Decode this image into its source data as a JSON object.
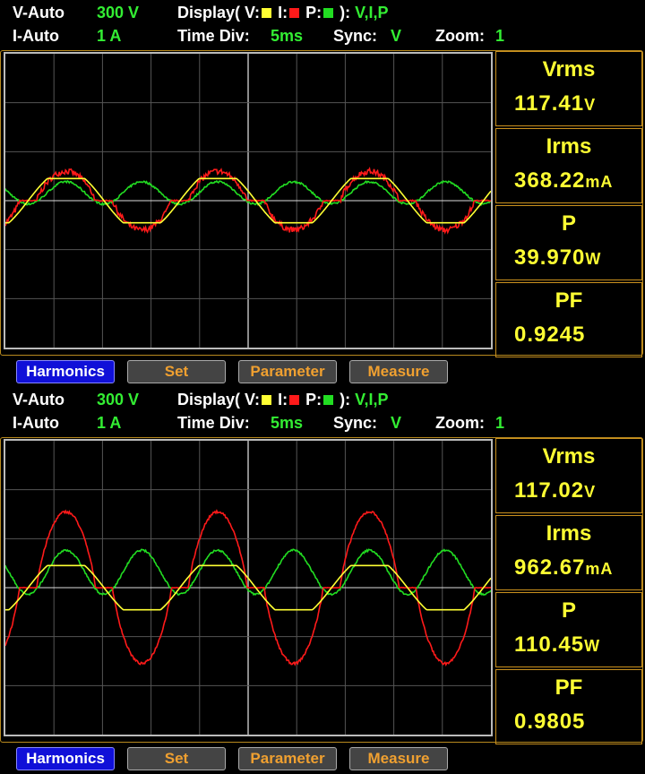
{
  "panels": [
    {
      "header": {
        "v_range_label": "V-Auto",
        "v_range_value": "300 V",
        "i_range_label": "I-Auto",
        "i_range_value": "1 A",
        "display_label": "Display(",
        "display_v": "V:",
        "display_i": "I:",
        "display_p": "P:",
        "display_close": "):",
        "display_value": "V,I,P",
        "time_div_label": "Time  Div:",
        "time_div_value": "5ms",
        "sync_label": "Sync:",
        "sync_value": "V",
        "zoom_label": "Zoom:",
        "zoom_value": "1"
      },
      "measurements": [
        {
          "label": "Vrms",
          "value": "117.41",
          "unit": "V"
        },
        {
          "label": "Irms",
          "value": "368.22",
          "unit": "mA"
        },
        {
          "label": "P",
          "value": "39.970",
          "unit": "W"
        },
        {
          "label": "PF",
          "value": "0.9245",
          "unit": ""
        }
      ],
      "softkeys": {
        "harmonics": "Harmonics",
        "set": "Set",
        "parameter": "Parameter",
        "measure": "Measure"
      }
    },
    {
      "header": {
        "v_range_label": "V-Auto",
        "v_range_value": "300 V",
        "i_range_label": "I-Auto",
        "i_range_value": "1 A",
        "display_label": "Display(",
        "display_v": "V:",
        "display_i": "I:",
        "display_p": "P:",
        "display_close": "):",
        "display_value": "V,I,P",
        "time_div_label": "Time  Div:",
        "time_div_value": "5ms",
        "sync_label": "Sync:",
        "sync_value": "V",
        "zoom_label": "Zoom:",
        "zoom_value": "1"
      },
      "measurements": [
        {
          "label": "Vrms",
          "value": "117.02",
          "unit": "V"
        },
        {
          "label": "Irms",
          "value": "962.67",
          "unit": "mA"
        },
        {
          "label": "P",
          "value": "110.45",
          "unit": "W"
        },
        {
          "label": "PF",
          "value": "0.9805",
          "unit": ""
        }
      ],
      "softkeys": {
        "harmonics": "Harmonics",
        "set": "Set",
        "parameter": "Parameter",
        "measure": "Measure"
      }
    }
  ],
  "colors": {
    "voltage_trace": "#ffff33",
    "current_trace": "#ff1a1a",
    "power_trace": "#22dd22",
    "grid": "#555555",
    "panel_border": "#c9901e",
    "text_green": "#33ee33",
    "measure_text": "#ffff33"
  },
  "waveforms": [
    {
      "voltage_amplitude": 0.55,
      "current_amplitude": 0.6,
      "power_amplitude": 0.38,
      "current_noise": 0.12
    },
    {
      "voltage_amplitude": 0.55,
      "current_amplitude": 1.55,
      "power_amplitude": 0.75,
      "current_noise": 0.05
    }
  ]
}
